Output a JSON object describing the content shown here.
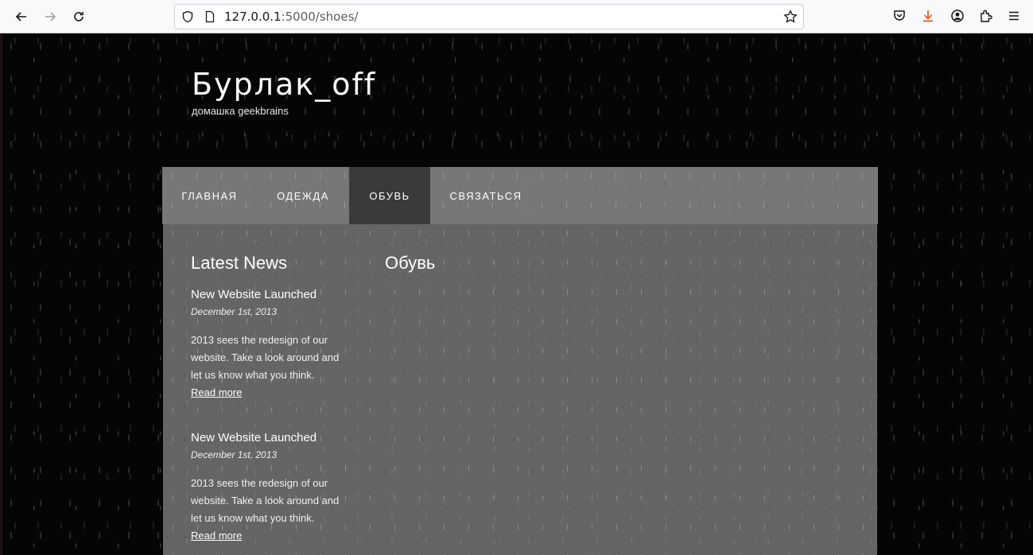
{
  "browser": {
    "url_host": "127.0.0.1",
    "url_path": ":5000/shoes/"
  },
  "site": {
    "title": "Бурлак_off",
    "subtitle": "домашка geekbrains"
  },
  "nav": {
    "items": [
      {
        "label": "ГЛАВНАЯ"
      },
      {
        "label": "ОДЕЖДА"
      },
      {
        "label": "ОБУВЬ"
      },
      {
        "label": "СВЯЗАТЬСЯ"
      }
    ],
    "active": "ОБУВЬ"
  },
  "sidebar": {
    "heading": "Latest News",
    "news": [
      {
        "title": "New Website Launched",
        "date": "December 1st, 2013",
        "text": "2013 sees the redesign of our website. Take a look around and let us know what you think.",
        "link": "Read more"
      },
      {
        "title": "New Website Launched",
        "date": "December 1st, 2013",
        "text": "2013 sees the redesign of our website. Take a look around and let us know what you think.",
        "link": "Read more"
      }
    ]
  },
  "main": {
    "heading": "Обувь"
  }
}
